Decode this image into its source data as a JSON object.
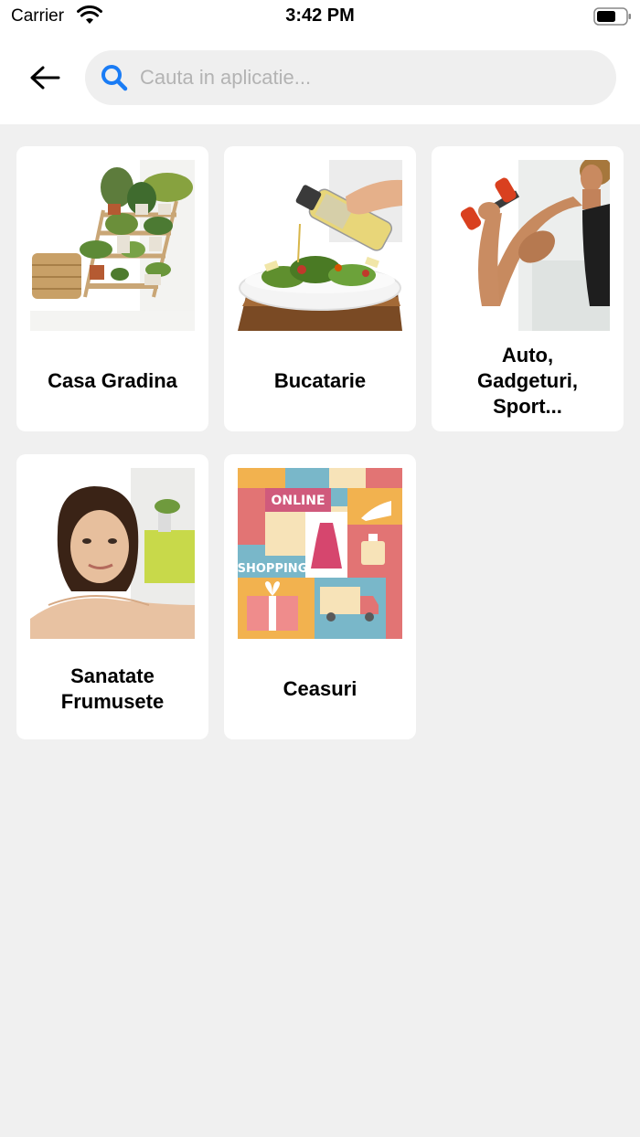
{
  "status_bar": {
    "carrier": "Carrier",
    "time": "3:42 PM"
  },
  "header": {
    "back_icon": "arrow-left-icon",
    "search": {
      "placeholder": "Cauta in aplicatie...",
      "value": "",
      "icon": "search-icon",
      "icon_color": "#1a7cf5"
    }
  },
  "categories": [
    {
      "label": "Casa Gradina",
      "image": "plant-shelf-image"
    },
    {
      "label": "Bucatarie",
      "image": "salad-bowl-image"
    },
    {
      "label": "Auto,\nGadgeturi,\nSport...",
      "image": "fitness-dumbbell-image"
    },
    {
      "label": "Sanatate\nFrumusete",
      "image": "woman-portrait-image"
    },
    {
      "label": "Ceasuri",
      "image": "shopping-collage-image"
    }
  ],
  "colors": {
    "page_background": "#f0f0f0",
    "card_background": "#ffffff",
    "search_background": "#efefef",
    "accent": "#1a7cf5"
  }
}
